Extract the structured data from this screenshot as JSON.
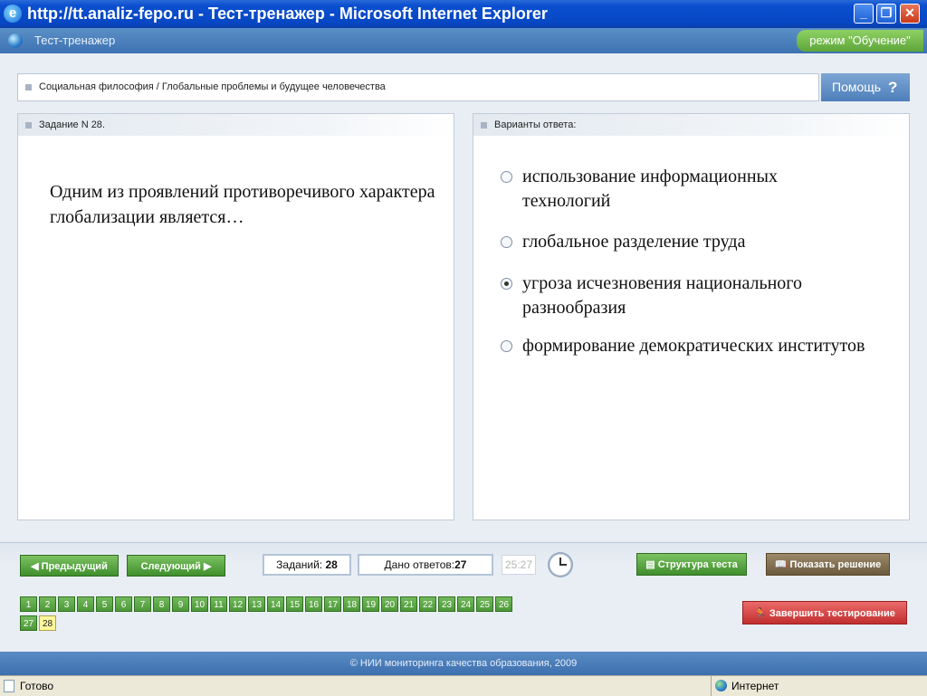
{
  "window": {
    "title": "http://tt.analiz-fepo.ru - Тест-тренажер - Microsoft Internet Explorer",
    "min_glyph": "_",
    "max_glyph": "❐",
    "close_glyph": "✕"
  },
  "app": {
    "title": "Тест-тренажер",
    "mode": "режим \"Обучение\""
  },
  "breadcrumb": "Социальная философия / Глобальные проблемы и будущее человечества",
  "help": {
    "label": "Помощь",
    "icon": "?"
  },
  "task": {
    "header": "Задание N 28.",
    "question": "Одним из проявлений противоречивого характера глобализации является…"
  },
  "answers": {
    "header": "Варианты ответа:",
    "options": [
      {
        "text": "использование информационных технологий",
        "selected": false
      },
      {
        "text": "глобальное разделение труда",
        "selected": false
      },
      {
        "text": "угроза исчезновения национального разнообразия",
        "selected": true
      },
      {
        "text": "формирование демократических институтов",
        "selected": false
      }
    ]
  },
  "nav": {
    "prev_label": "Предыдущий",
    "next_label": "Следующий",
    "tasks_label": "Заданий:",
    "tasks_count": "28",
    "answered_label": "Дано ответов:",
    "answered_count": "27",
    "timer": "25:27",
    "structure_label": "Структура теста",
    "solution_label": "Показать решение",
    "finish_label": "Завершить тестирование",
    "question_numbers": [
      "1",
      "2",
      "3",
      "4",
      "5",
      "6",
      "7",
      "8",
      "9",
      "10",
      "11",
      "12",
      "13",
      "14",
      "15",
      "16",
      "17",
      "18",
      "19",
      "20",
      "21",
      "22",
      "23",
      "24",
      "25",
      "26",
      "27",
      "28"
    ],
    "current_question": "28"
  },
  "footer": "© НИИ мониторинга качества образования, 2009",
  "status": {
    "text": "Готово",
    "zone": "Интернет"
  }
}
